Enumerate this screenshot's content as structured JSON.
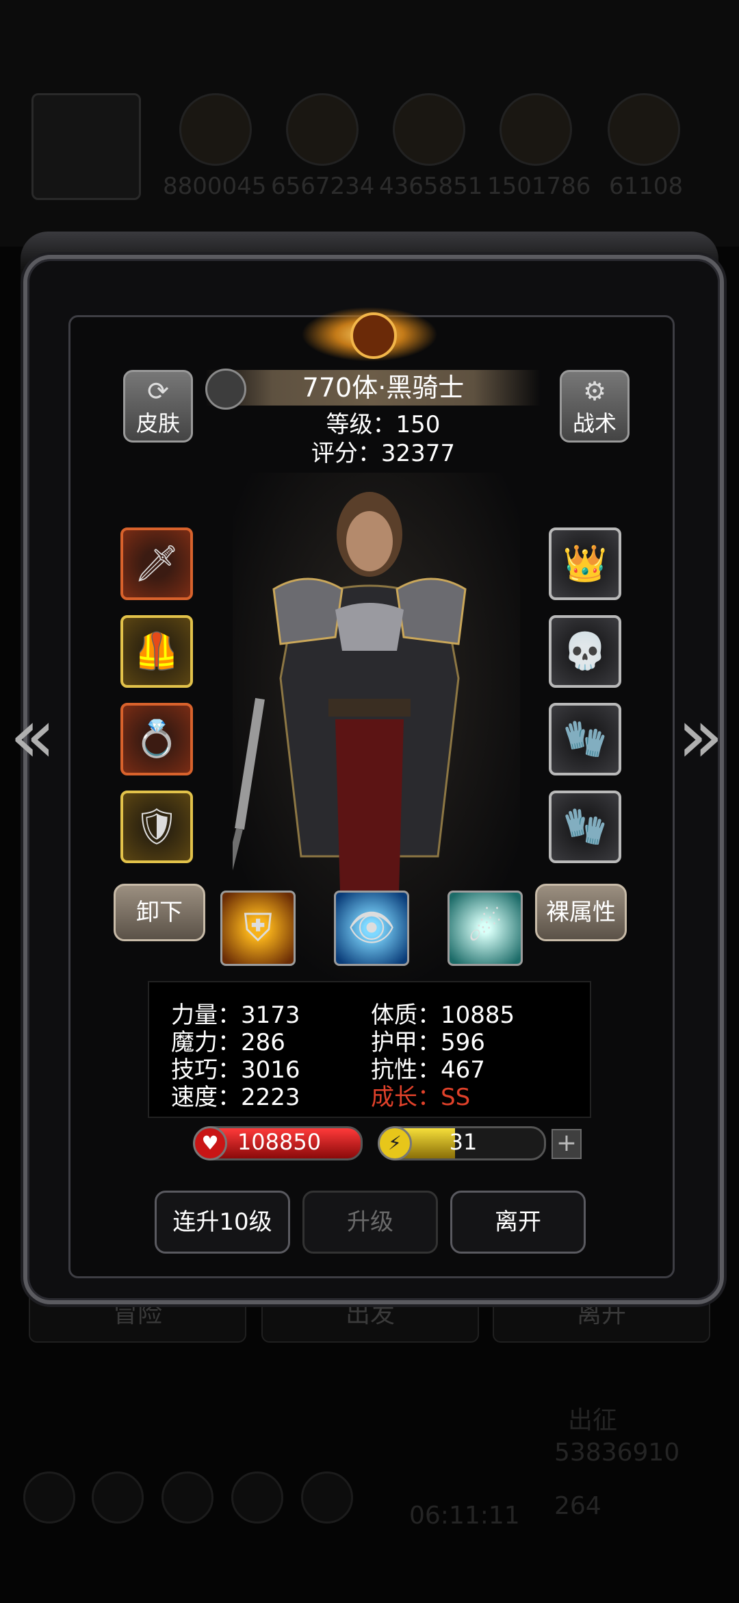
{
  "background": {
    "resource_values": [
      "8800045",
      "6567234",
      "4365851",
      "1501786",
      "61108"
    ],
    "bottom_buttons": [
      "冒险",
      "出发",
      "离开"
    ],
    "expedition_label": "出征",
    "gold_value": "53836910",
    "gem_value": "264",
    "timer": "06:11:11"
  },
  "header": {
    "title": "770体·黑骑士",
    "level": "等级：150",
    "score": "评分：32377"
  },
  "side_buttons": {
    "skin": "皮肤",
    "tactics": "战术"
  },
  "actions": {
    "unequip": "卸下",
    "base_attr": "裸属性"
  },
  "stats": {
    "strength": "力量：3173",
    "magic": "魔力：286",
    "skill": "技巧：3016",
    "speed": "速度：2223",
    "constitution": "体质：10885",
    "armor": "护甲：596",
    "resistance": "抗性：467",
    "growth": "成长：SS"
  },
  "bars": {
    "hp": "108850",
    "energy": "31",
    "energy_fill": 0.45,
    "plus": "+"
  },
  "buttons": {
    "level10": "连升10级",
    "upgrade": "升级",
    "leave": "离开"
  },
  "colors": {
    "hp_red": "#d01414",
    "energy_yellow": "#e7c61a",
    "growth_red": "#e0412a"
  }
}
